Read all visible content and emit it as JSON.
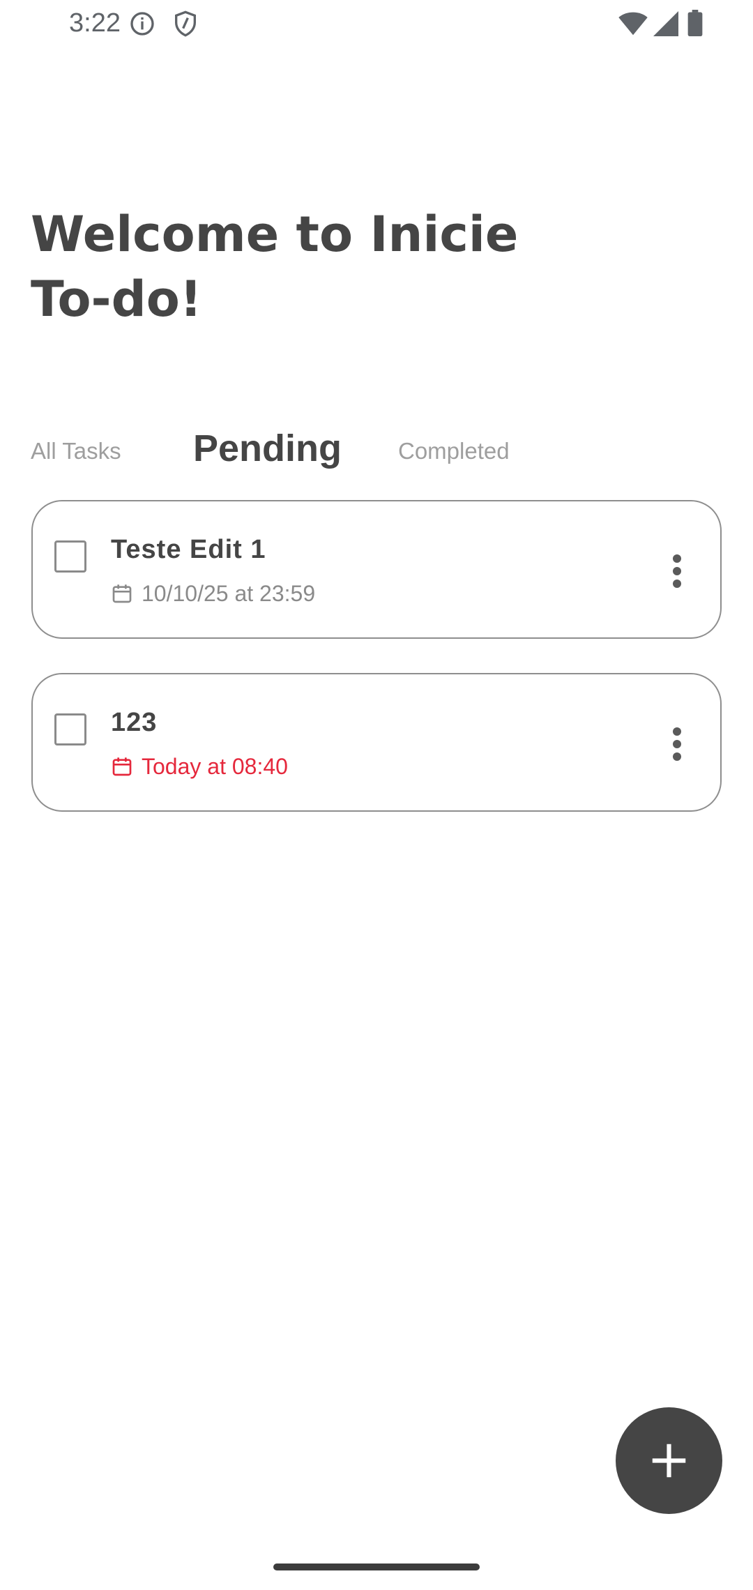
{
  "status_bar": {
    "time": "3:22",
    "icons": [
      "info-icon",
      "shield-icon",
      "wifi-icon",
      "signal-icon",
      "battery-icon"
    ]
  },
  "header": {
    "title": "Welcome to Inicie To-do!"
  },
  "tabs": [
    {
      "label": "All Tasks",
      "selected": false
    },
    {
      "label": "Pending",
      "selected": true
    },
    {
      "label": "Completed",
      "selected": false
    }
  ],
  "tasks": [
    {
      "title": "Teste Edit 1",
      "due": "10/10/25 at 23:59",
      "overdue": false,
      "checked": false
    },
    {
      "title": "123",
      "due": "Today at 08:40",
      "overdue": true,
      "checked": false
    }
  ],
  "fab": {
    "icon": "plus-icon"
  },
  "colors": {
    "primary_text": "#454545",
    "muted_text": "#9e9e9e",
    "overdue": "#e5283c",
    "fab_background": "#454545"
  }
}
